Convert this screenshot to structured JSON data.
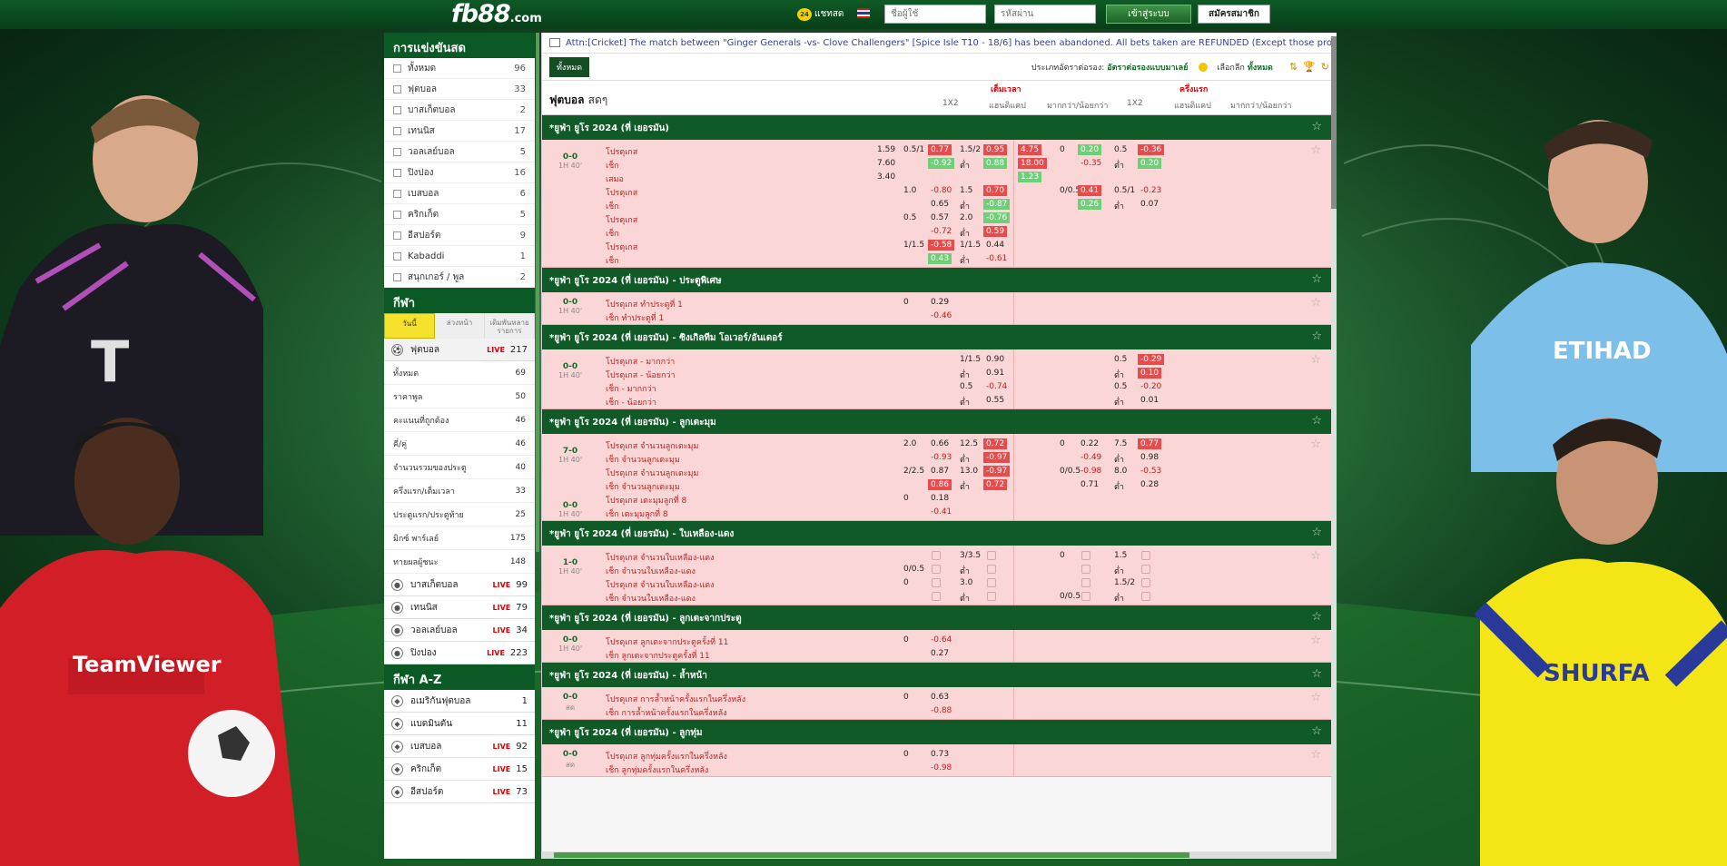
{
  "header": {
    "logo": "fb88",
    "logo_suffix": ".com",
    "chat": "แชทสด",
    "username_placeholder": "ชื่อผู้ใช้",
    "password_placeholder": "รหัสผ่าน",
    "login": "เข้าสู่ระบบ",
    "register": "สมัครสมาชิก"
  },
  "sidebar": {
    "live_title": "การแข่งขันสด",
    "live_items": [
      {
        "label": "ทั้งหมด",
        "count": "96"
      },
      {
        "label": "ฟุตบอล",
        "count": "33"
      },
      {
        "label": "บาสเก็ตบอล",
        "count": "2"
      },
      {
        "label": "เทนนิส",
        "count": "17"
      },
      {
        "label": "วอลเลย์บอล",
        "count": "5"
      },
      {
        "label": "ปิงปอง",
        "count": "16"
      },
      {
        "label": "เบสบอล",
        "count": "6"
      },
      {
        "label": "คริกเก็ต",
        "count": "5"
      },
      {
        "label": "อีสปอร์ต",
        "count": "9"
      },
      {
        "label": "Kabaddi",
        "count": "1"
      },
      {
        "label": "สนุกเกอร์ / พูล",
        "count": "2"
      }
    ],
    "sports_title": "กีฬา",
    "tabs": [
      "วันนี้",
      "ล่วงหน้า",
      "เดิมพันหลายรายการ"
    ],
    "football": {
      "label": "ฟุตบอล",
      "live": "LIVE",
      "count": "217"
    },
    "football_sub": [
      {
        "label": "ทั้งหมด",
        "count": "69"
      },
      {
        "label": "ราคาพูล",
        "count": "50"
      },
      {
        "label": "คะแนนที่ถูกต้อง",
        "count": "46"
      },
      {
        "label": "คี่/คู่",
        "count": "46"
      },
      {
        "label": "จำนวนรวมของประตู",
        "count": "40"
      },
      {
        "label": "ครึ่งแรก/เต็มเวลา",
        "count": "33"
      },
      {
        "label": "ประตูแรก/ประตูท้าย",
        "count": "25"
      },
      {
        "label": "มิกซ์ พาร์เลย์",
        "count": "175"
      },
      {
        "label": "ทายผลผู้ชนะ",
        "count": "148"
      }
    ],
    "sports": [
      {
        "label": "บาสเก็ตบอล",
        "live": "LIVE",
        "count": "99"
      },
      {
        "label": "เทนนิส",
        "live": "LIVE",
        "count": "79"
      },
      {
        "label": "วอลเลย์บอล",
        "live": "LIVE",
        "count": "34"
      },
      {
        "label": "ปิงปอง",
        "live": "LIVE",
        "count": "223"
      }
    ],
    "az_title": "กีฬา A-Z",
    "az": [
      {
        "label": "อเมริกันฟุตบอล",
        "live": "",
        "count": "1"
      },
      {
        "label": "แบดมินตัน",
        "live": "",
        "count": "11"
      },
      {
        "label": "เบสบอล",
        "live": "LIVE",
        "count": "92"
      },
      {
        "label": "คริกเก็ต",
        "live": "LIVE",
        "count": "15"
      },
      {
        "label": "อีสปอร์ต",
        "live": "LIVE",
        "count": "73"
      }
    ]
  },
  "main": {
    "ticker": "Attn:[Cricket] The match between \"Ginger Generals -vs- Clove Challengers\" [Spice Isle T10 - 18/6] has been abandoned. All bets taken are REFUNDED (Except those products which have",
    "tab_all": "ทั้งหมด",
    "odds_type_label": "ประเภทอัตราต่อรอง:",
    "odds_type_value": "อัตราต่อรองแบบมาเลย์",
    "select_label": "เลือกลีก",
    "select_value": "ทั้งหมด",
    "title": "ฟุตบอล",
    "title_sub": "สดๆ",
    "group_full": "เต็มเวลา",
    "group_half": "ครึ่งแรก",
    "cols": [
      "1X2",
      "แฮนดิแคป",
      "มากกว่า/น้อยกว่า",
      "1X2",
      "แฮนดิแคป",
      "มากกว่า/น้อยกว่า"
    ]
  },
  "leagues": [
    {
      "title": "*ยูฟ่า ยูโร 2024 (ที่ เยอรมัน)",
      "score": "0-0",
      "time": "1H 40'",
      "rows": [
        {
          "team": "โปรตุเกส",
          "x12": "1.59",
          "hl": "0.5/1",
          "ho": "0.77",
          "ol": "1.5/2",
          "oo": "0.95",
          "hx": "4.75",
          "hhl": "0",
          "hho": "0.20",
          "hol": "0.5",
          "hoo": "-0.36"
        },
        {
          "team": "เช็ก",
          "x12": "7.60",
          "ho": "-0.92",
          "ol": "ต่ำ",
          "oo": "0.88",
          "hx": "18.00",
          "hho": "-0.35",
          "hol": "ต่ำ",
          "hoo": "0.20"
        },
        {
          "team": "เสมอ",
          "x12": "3.40",
          "hx": "1.23"
        },
        {
          "team": "โปรตุเกส",
          "hl": "1.0",
          "ho": "-0.80",
          "ol": "1.5",
          "oo": "0.70",
          "hhl": "0/0.5",
          "hho": "0.41",
          "hol": "0.5/1",
          "hoo": "-0.23"
        },
        {
          "team": "เช็ก",
          "ho": "0.65",
          "ol": "ต่ำ",
          "oo": "-0.87",
          "hho": "0.26",
          "hol": "ต่ำ",
          "hoo": "0.07"
        },
        {
          "team": "โปรตุเกส",
          "hl": "0.5",
          "ho": "0.57",
          "ol": "2.0",
          "oo": "-0.76"
        },
        {
          "team": "เช็ก",
          "ho": "-0.72",
          "ol": "ต่ำ",
          "oo": "0.59"
        },
        {
          "team": "โปรตุเกส",
          "hl": "1/1.5",
          "ho": "-0.58",
          "ol": "1/1.5",
          "oo": "0.44"
        },
        {
          "team": "เช็ก",
          "ho": "0.43",
          "ol": "ต่ำ",
          "oo": "-0.61"
        }
      ]
    },
    {
      "title": "*ยูฟ่า ยูโร 2024 (ที่ เยอรมัน) - ประตูพิเศษ",
      "score": "0-0",
      "time": "1H 40'",
      "rows": [
        {
          "team": "โปรตุเกส ทำประตูที่ 1",
          "hl": "0",
          "ho": "0.29"
        },
        {
          "team": "เช็ก ทำประตูที่ 1",
          "ho": "-0.46"
        }
      ]
    },
    {
      "title": "*ยูฟ่า ยูโร 2024 (ที่ เยอรมัน) - ซิงเกิลทีม โอเวอร์/อันเดอร์",
      "score": "0-0",
      "time": "1H 40'",
      "rows": [
        {
          "team": "โปรตุเกส - มากกว่า",
          "ol": "1/1.5",
          "oo": "0.90",
          "hol": "0.5",
          "hoo": "-0.29"
        },
        {
          "team": "โปรตุเกส - น้อยกว่า",
          "ol": "ต่ำ",
          "oo": "0.91",
          "hol": "ต่ำ",
          "hoo": "0.10"
        },
        {
          "team": "เช็ก - มากกว่า",
          "ol": "0.5",
          "oo": "-0.74",
          "hol": "0.5",
          "hoo": "-0.20"
        },
        {
          "team": "เช็ก - น้อยกว่า",
          "ol": "ต่ำ",
          "oo": "0.55",
          "hol": "ต่ำ",
          "hoo": "0.01"
        }
      ]
    },
    {
      "title": "*ยูฟ่า ยูโร 2024 (ที่ เยอรมัน) - ลูกเตะมุม",
      "score": "7-0",
      "time": "1H 40'",
      "score2": "0-0",
      "time2": "1H 40'",
      "rows": [
        {
          "team": "โปรตุเกส จำนวนลูกเตะมุม",
          "hl": "2.0",
          "ho": "0.66",
          "ol": "12.5",
          "oo": "0.72",
          "hhl": "0",
          "hho": "0.22",
          "hol": "7.5",
          "hoo": "0.77"
        },
        {
          "team": "เช็ก จำนวนลูกเตะมุม",
          "ho": "-0.93",
          "ol": "ต่ำ",
          "oo": "-0.97",
          "hho": "-0.49",
          "hol": "ต่ำ",
          "hoo": "0.98"
        },
        {
          "team": "โปรตุเกส จำนวนลูกเตะมุม",
          "hl": "2/2.5",
          "ho": "0.87",
          "ol": "13.0",
          "oo": "-0.97",
          "hhl": "0/0.5",
          "hho": "-0.98",
          "hol": "8.0",
          "hoo": "-0.53"
        },
        {
          "team": "เช็ก จำนวนลูกเตะมุม",
          "ho": "0.86",
          "ol": "ต่ำ",
          "oo": "0.72",
          "hho": "0.71",
          "hol": "ต่ำ",
          "hoo": "0.28"
        },
        {
          "team": "โปรตุเกส เตะมุมลูกที่ 8",
          "hl": "0",
          "ho": "0.18"
        },
        {
          "team": "เช็ก เตะมุมลูกที่ 8",
          "ho": "-0.41"
        }
      ]
    },
    {
      "title": "*ยูฟ่า ยูโร 2024 (ที่ เยอรมัน) - ใบเหลือง-แดง",
      "score": "1-0",
      "time": "1H 40'",
      "rows": [
        {
          "team": "โปรตุเกส จำนวนใบเหลือง-แดง",
          "ol": "3/3.5",
          "hhl": "0",
          "hol": "1.5"
        },
        {
          "team": "เช็ก จำนวนใบเหลือง-แดง",
          "hl": "0/0.5",
          "ol": "ต่ำ",
          "hol": "ต่ำ"
        },
        {
          "team": "โปรตุเกส จำนวนใบเหลือง-แดง",
          "hl": "0",
          "ol": "3.0",
          "hol": "1.5/2"
        },
        {
          "team": "เช็ก จำนวนใบเหลือง-แดง",
          "ol": "ต่ำ",
          "hhl": "0/0.5",
          "hol": "ต่ำ"
        }
      ]
    },
    {
      "title": "*ยูฟ่า ยูโร 2024 (ที่ เยอรมัน) - ลูกเตะจากประตู",
      "score": "0-0",
      "time": "1H 40'",
      "rows": [
        {
          "team": "โปรตุเกส ลูกเตะจากประตูครั้งที่ 11",
          "hl": "0",
          "ho": "-0.64"
        },
        {
          "team": "เช็ก ลูกเตะจากประตูครั้งที่ 11",
          "ho": "0.27"
        }
      ]
    },
    {
      "title": "*ยูฟ่า ยูโร 2024 (ที่ เยอรมัน) - ล้ำหน้า",
      "score": "0-0",
      "time": "สด",
      "rows": [
        {
          "team": "โปรตุเกส การล้ำหน้าครั้งแรกในครึ่งหลัง",
          "hl": "0",
          "ho": "0.63"
        },
        {
          "team": "เช็ก การล้ำหน้าครั้งแรกในครึ่งหลัง",
          "ho": "-0.88"
        }
      ]
    },
    {
      "title": "*ยูฟ่า ยูโร 2024 (ที่ เยอรมัน) - ลูกทุ่ม",
      "score": "0-0",
      "time": "สด",
      "rows": [
        {
          "team": "โปรตุเกส ลูกทุ่มครั้งแรกในครึ่งหลัง",
          "hl": "0",
          "ho": "0.73"
        },
        {
          "team": "เช็ก ลูกทุ่มครั้งแรกในครึ่งหลัง",
          "ho": "-0.98"
        }
      ]
    }
  ]
}
